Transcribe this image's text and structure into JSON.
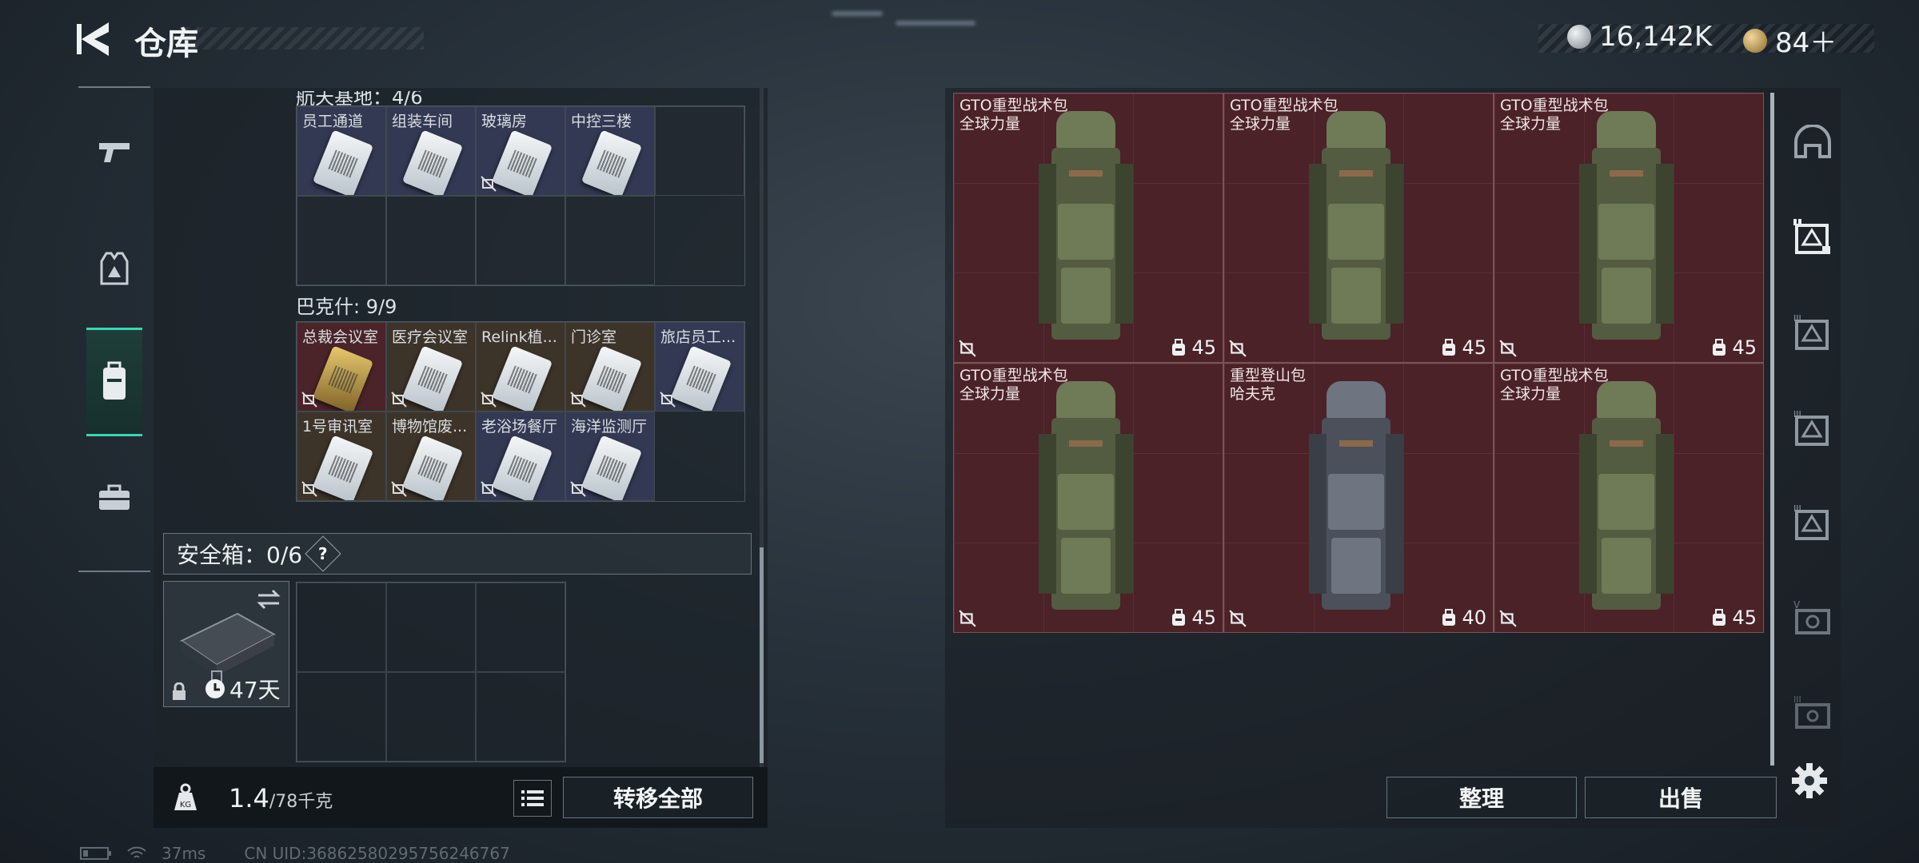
{
  "header": {
    "title": "仓库",
    "back_icon": "back-arrow-icon"
  },
  "currency": [
    {
      "icon": "silver-coin-icon",
      "value": "16,142K",
      "color": "#c9cdd1"
    },
    {
      "icon": "triangle-coin-icon",
      "value": "84＋",
      "color": "#d6b06a"
    }
  ],
  "left_nav": [
    "gun-icon",
    "vest-icon",
    "backpack-icon",
    "briefcase-icon"
  ],
  "keys_top": {
    "label": "航天基地：4/6",
    "items": [
      "员工通道",
      "组装车间",
      "玻璃房",
      "中控三楼"
    ]
  },
  "keys_bakesh": {
    "label": "巴克什: 9/9",
    "row1": [
      "总裁会议室",
      "医疗会议室",
      "Relink植...",
      "门诊室",
      "旅店员工..."
    ],
    "row2": [
      "1号审讯室",
      "博物馆废...",
      "老浴场餐厅",
      "海洋监测厅"
    ]
  },
  "safe_box": {
    "label": "安全箱：0/6",
    "help": "?",
    "case_timer": "47天"
  },
  "footer_left": {
    "weight": "1.4",
    "capacity": "/78千克",
    "transfer_all": "转移全部"
  },
  "bags": [
    {
      "line1": "GTO重型战术包",
      "line2": "全球力量",
      "capacity": "45",
      "color": "green"
    },
    {
      "line1": "GTO重型战术包",
      "line2": "全球力量",
      "capacity": "45",
      "color": "green"
    },
    {
      "line1": "GTO重型战术包",
      "line2": "全球力量",
      "capacity": "45",
      "color": "green"
    },
    {
      "line1": "GTO重型战术包",
      "line2": "全球力量",
      "capacity": "45",
      "color": "green"
    },
    {
      "line1": "重型登山包",
      "line2": "哈夫克",
      "capacity": "40",
      "color": "grey"
    },
    {
      "line1": "GTO重型战术包",
      "line2": "全球力量",
      "capacity": "45",
      "color": "green"
    }
  ],
  "actions": {
    "sort": "整理",
    "sell": "出售"
  },
  "right_nav": [
    "helmet-icon",
    "tier-frame-icon",
    "tier-3-frame-icon",
    "tier-3-frame-icon",
    "tier-3-frame-icon",
    "tier-v-frame-icon",
    "tier-3-frame-icon"
  ],
  "status": {
    "ping": "37ms",
    "uid": "CN UID:36862580295756246767"
  }
}
